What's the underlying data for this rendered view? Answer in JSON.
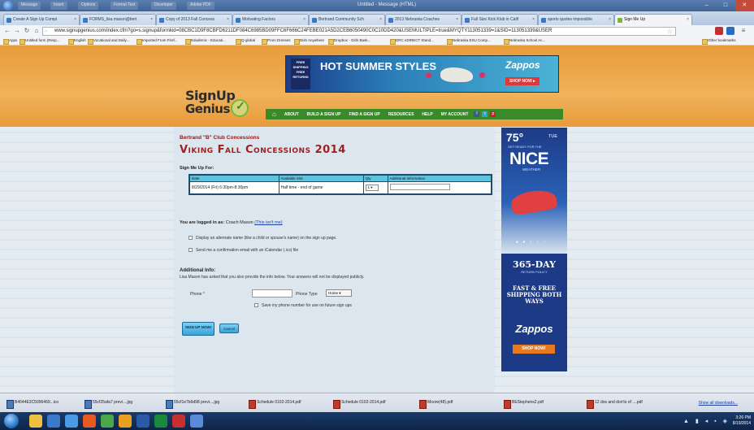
{
  "window": {
    "title": "Untitled - Message (HTML)",
    "menus": [
      "Message",
      "Insert",
      "Options",
      "Format Text",
      "Developer",
      "Adobe PDF"
    ]
  },
  "tabs": [
    {
      "label": "Create A Sign Up Compl"
    },
    {
      "label": "FORMS_lisa.mason@bert"
    },
    {
      "label": "Copy of 2013 Fall Concess"
    },
    {
      "label": "Motivating Factors"
    },
    {
      "label": "Bertrand Community Sch"
    },
    {
      "label": "2013 Nebraska Coaches"
    },
    {
      "label": "Fall Size Kick Klub in Calif"
    },
    {
      "label": "sports quotes impossible"
    },
    {
      "label": "Sign Me Up"
    }
  ],
  "address": {
    "url": "www.signupgenius.com/index.cfm?go=s.signup&formkid=08CBC1D9F8CBFD6211DF084C6985BD09FFC6F666C24FEBE021A5D2CEB6050490C0C10DD420&USEMULTIPLE=true&MYQTY113051339=1&SID=113051339&USER"
  },
  "bookmarks": [
    "Apps",
    "Untitled form (Resp...",
    "English",
    "Vocational and Daily...",
    "Imported From Firef...",
    "Edudemic - Educati...",
    "Q-global",
    "Prom Dresses",
    "Dish Anywhere",
    "Dropbox - Girls Bask...",
    "DRC eDIRECT Stand...",
    "Nebraska ESU Comp...",
    "Nebraska School Ac...",
    "Other bookmarks"
  ],
  "header": {
    "logo_line1": "SignUp",
    "logo_line2": "Genius",
    "ad_free": "FREE SHIPPING FREE RETURNS",
    "ad_headline": "HOT SUMMER STYLES",
    "ad_brand": "Zappos",
    "ad_cta": "SHOP NOW ▸"
  },
  "nav": {
    "items": [
      "ABOUT",
      "BUILD A SIGN UP",
      "FIND A SIGN UP",
      "RESOURCES",
      "HELP",
      "MY ACCOUNT"
    ]
  },
  "form": {
    "organization": "Bertrand \"B\" Club Concessions",
    "title": "Viking Fall Concessions 2014",
    "signme_label": "Sign Me Up For:",
    "table": {
      "headers": [
        "Date",
        "Available Slot",
        "Qty",
        "Additional Information"
      ],
      "row": {
        "date": "8/29/2014 (Fri) 6:30pm-8:30pm",
        "slot": "Half time - end of game",
        "qty": "1 ▾"
      }
    },
    "logged_label": "You are logged in as:",
    "logged_user": "Coach Mason",
    "not_me": "(This isn't me)",
    "option_alt_name": "Display an alternate name (like a child or spouse's name) on the sign up page.",
    "option_confirm": "Send me a confirmation email with an iCalendar (.ics) file",
    "additional_header": "Additional Info:",
    "additional_text": "Lisa Mason has asked that you also provide the info below. Your answers will not be displayed publicly.",
    "phone_label": "Phone *",
    "phone_type_label": "Phone Type",
    "phone_type_value": "Home ▾",
    "save_phone": "Save my phone number for use on future sign ups",
    "signup_btn": "SIGN UP NOW!",
    "cancel_btn": "Cancel"
  },
  "sidead": {
    "temp": "75°",
    "day": "TUE",
    "getready": "GET READY FOR THE",
    "big": "NICE",
    "weather": "WEATHER",
    "days": "365-DAY",
    "policy": "RETURN POLICY",
    "fast": "FAST & FREE SHIPPING BOTH WAYS",
    "brand": "Zappos",
    "cta": "SHOP NOW!"
  },
  "downloads": {
    "items": [
      "B4644E3C5096469...ico",
      "55cf25afa7 previ....jpg",
      "55cf1e7b6d98 previ....jpg",
      "Schedule 0102-2014.pdf",
      "Schedule 0102-2014.pdf",
      "Moore(48).pdf",
      "BEStephens2.pdf",
      "12 dos and don'ts of ....pdf"
    ],
    "show_all": "Show all downloads..."
  },
  "taskbar": {
    "time": "3:26 PM",
    "date": "8/19/2014"
  }
}
